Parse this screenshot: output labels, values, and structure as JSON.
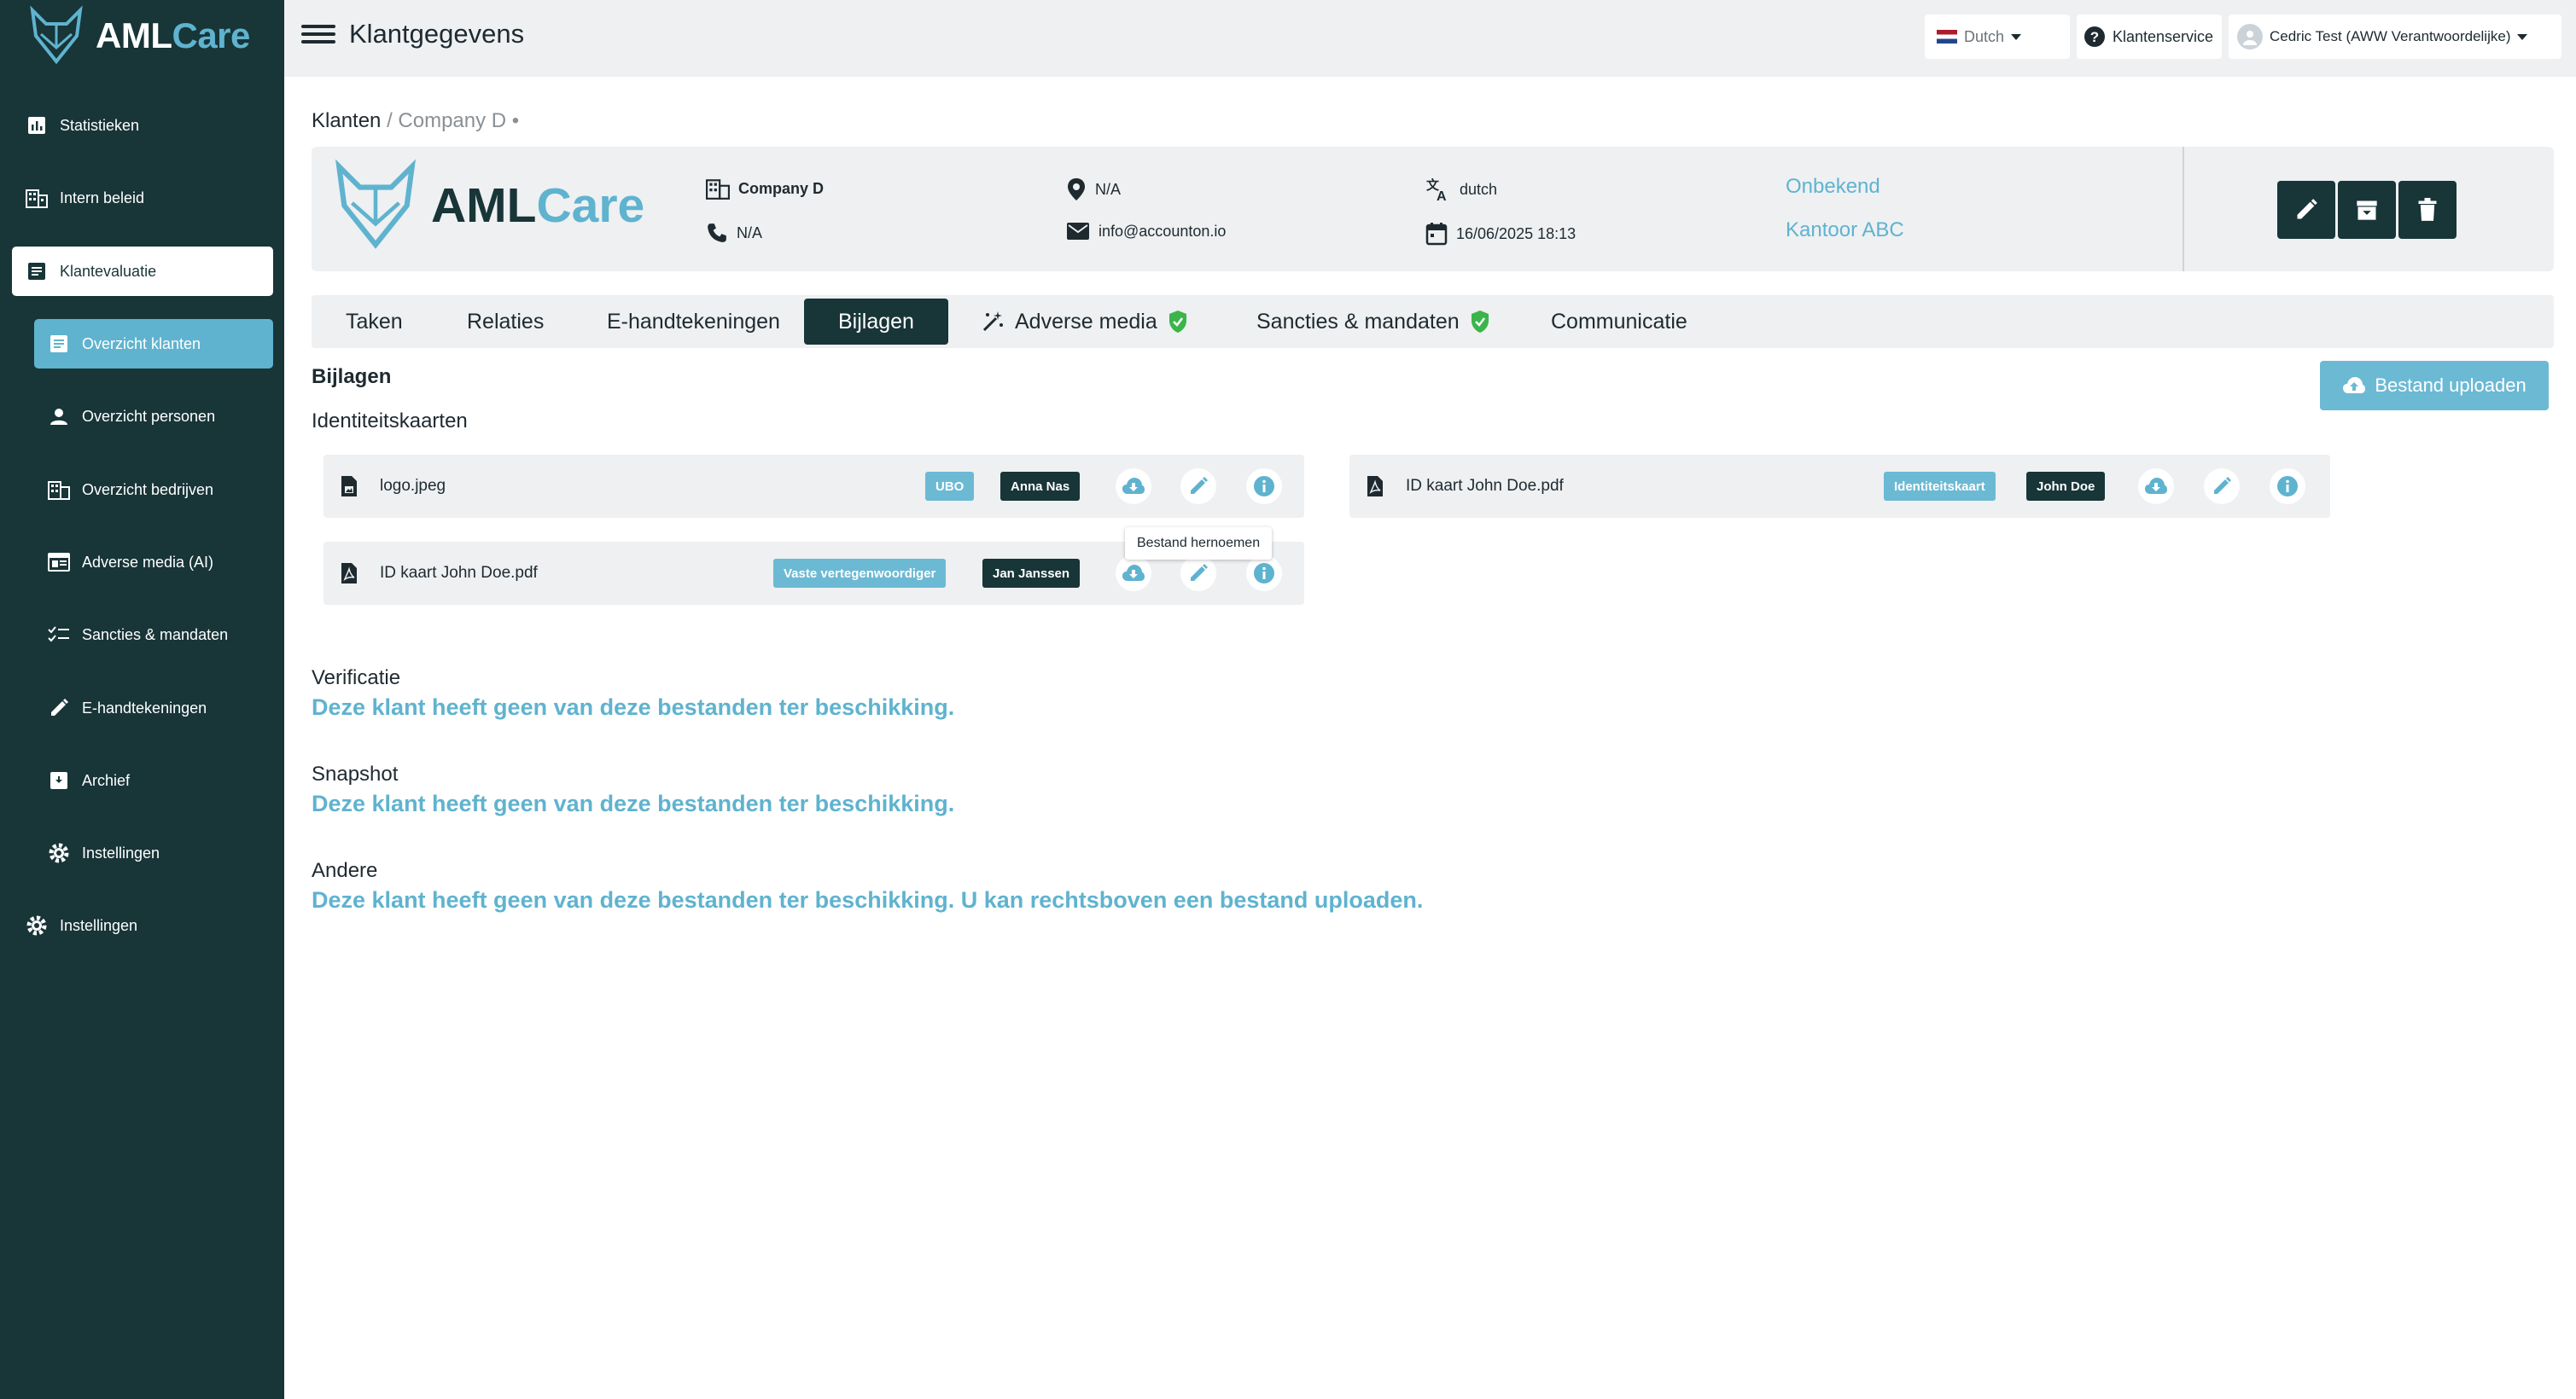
{
  "brand": {
    "aml": "AML",
    "care": "Care"
  },
  "sidebar": {
    "items": [
      {
        "label": "Statistieken",
        "icon": "bar-chart-icon"
      },
      {
        "label": "Intern beleid",
        "icon": "building-icon"
      },
      {
        "label": "Klantevaluatie",
        "icon": "document-icon"
      },
      {
        "label": "Overzicht klanten",
        "icon": "document-icon"
      },
      {
        "label": "Overzicht personen",
        "icon": "person-icon"
      },
      {
        "label": "Overzicht bedrijven",
        "icon": "building-icon"
      },
      {
        "label": "Adverse media (AI)",
        "icon": "newspaper-icon"
      },
      {
        "label": "Sancties & mandaten",
        "icon": "checklist-icon"
      },
      {
        "label": "E-handtekeningen",
        "icon": "pen-icon"
      },
      {
        "label": "Archief",
        "icon": "archive-icon"
      },
      {
        "label": "Instellingen",
        "icon": "gear-icon"
      },
      {
        "label": "Instellingen",
        "icon": "gear-icon"
      }
    ]
  },
  "topbar": {
    "title": "Klantgegevens",
    "language": "Dutch",
    "support": "Klantenservice",
    "user": "Cedric Test (AWW Verantwoordelijke)"
  },
  "breadcrumb": {
    "root": "Klanten",
    "current": "/ Company D •"
  },
  "client": {
    "name": "Company D",
    "phone": "N/A",
    "location": "N/A",
    "email": "info@accounton.io",
    "language": "dutch",
    "date": "16/06/2025 18:13",
    "status": "Onbekend",
    "office": "Kantoor ABC"
  },
  "tabs": [
    {
      "label": "Taken"
    },
    {
      "label": "Relaties"
    },
    {
      "label": "E-handtekeningen"
    },
    {
      "label": "Bijlagen"
    },
    {
      "label": "Adverse media"
    },
    {
      "label": "Sancties & mandaten"
    },
    {
      "label": "Communicatie"
    }
  ],
  "content": {
    "heading": "Bijlagen",
    "upload_label": "Bestand uploaden",
    "id_section": "Identiteitskaarten",
    "files": [
      {
        "name": "logo.jpeg",
        "type": "UBO",
        "person": "Anna Nas"
      },
      {
        "name": "ID kaart John Doe.pdf",
        "type": "Vaste vertegenwoordiger",
        "person": "Jan Janssen"
      },
      {
        "name": "ID kaart John Doe.pdf",
        "type": "Identiteitskaart",
        "person": "John Doe"
      }
    ],
    "tooltip": "Bestand hernoemen",
    "sections": [
      {
        "title": "Verificatie",
        "message": "Deze klant heeft geen van deze bestanden ter beschikking."
      },
      {
        "title": "Snapshot",
        "message": "Deze klant heeft geen van deze bestanden ter beschikking."
      },
      {
        "title": "Andere",
        "message": "Deze klant heeft geen van deze bestanden ter beschikking. U kan rechtsboven een bestand uploaden."
      }
    ]
  },
  "colors": {
    "sidebar": "#183538",
    "accent": "#5fb3cf",
    "badge_blue": "#6cb9d4",
    "shield_green": "#3bb54a"
  }
}
